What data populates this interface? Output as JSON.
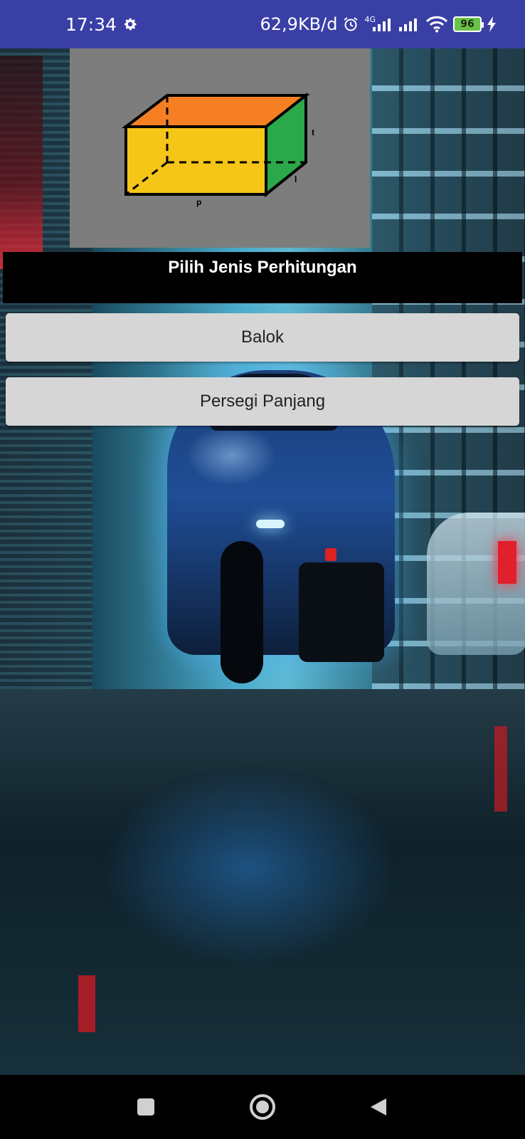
{
  "status_bar": {
    "time": "17:34",
    "network_speed": "62,9KB/d",
    "network_type": "4G",
    "battery_level": "96",
    "icons": [
      "gear-icon",
      "alarm-icon",
      "signal-icon",
      "signal-icon",
      "wifi-icon",
      "battery-icon",
      "charging-icon"
    ]
  },
  "illustration": {
    "label_length": "p",
    "label_width": "l",
    "label_height": "t",
    "colors": {
      "front": "#f5c518",
      "top": "#f57f22",
      "side": "#2aa84a",
      "background": "#7d7d7d"
    }
  },
  "header": {
    "title": "Pilih Jenis Perhitungan"
  },
  "buttons": {
    "balok": "Balok",
    "persegi_panjang": "Persegi Panjang"
  },
  "nav_bar": {
    "icons": [
      "recent-apps-icon",
      "home-icon",
      "back-icon"
    ]
  },
  "colors": {
    "status_bar": "#3a3fa6",
    "button_bg": "#d6d6d6",
    "header_bg": "#000000"
  }
}
